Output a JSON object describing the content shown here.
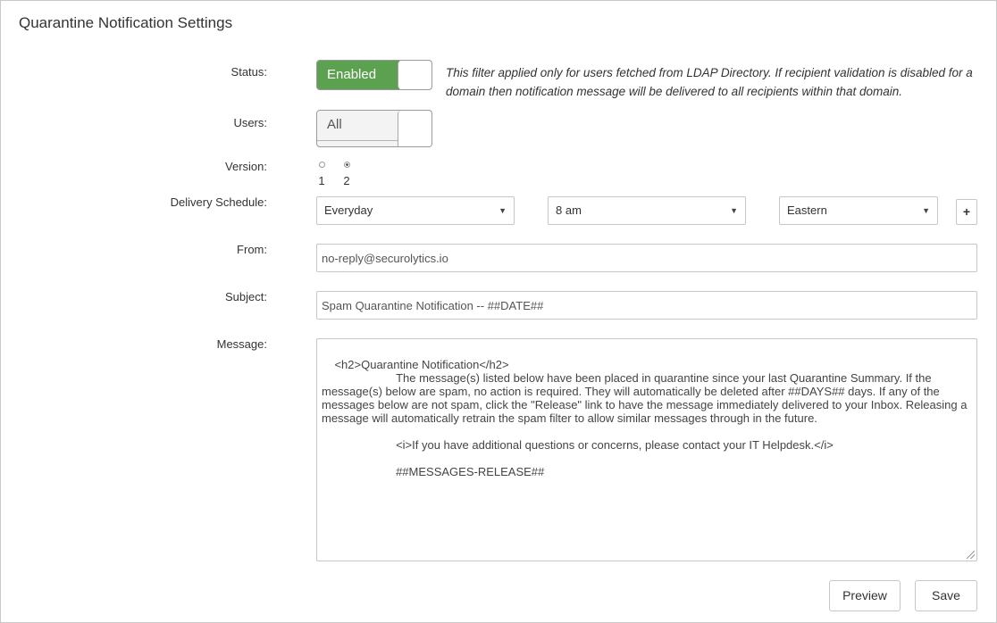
{
  "panel": {
    "title": "Quarantine Notification Settings"
  },
  "status": {
    "label": "Status:",
    "toggle_text": "Enabled",
    "state": "on",
    "hint": "This filter applied only for users fetched from LDAP Directory. If recipient validation is disabled for a domain then notification message will be delivered to all recipients within that domain."
  },
  "users": {
    "label": "Users:",
    "toggle_text": "All",
    "state": "off"
  },
  "version": {
    "label": "Version:",
    "options": [
      "1",
      "2"
    ],
    "selected": "2"
  },
  "delivery": {
    "label": "Delivery Schedule:",
    "frequency": "Everyday",
    "time": "8 am",
    "timezone": "Eastern",
    "add_label": "+"
  },
  "from": {
    "label": "From:",
    "value": "no-reply@securolytics.io"
  },
  "subject": {
    "label": "Subject:",
    "value": "Spam Quarantine Notification -- ##DATE##"
  },
  "message": {
    "label": "Message:",
    "value": "<h2>Quarantine Notification</h2>\n                       The message(s) listed below have been placed in quarantine since your last Quarantine Summary. If the message(s) below are spam, no action is required. They will automatically be deleted after ##DAYS## days. If any of the messages below are not spam, click the \"Release\" link to have the message immediately delivered to your Inbox. Releasing a message will automatically retrain the spam filter to allow similar messages through in the future.\n\n                       <i>If you have additional questions or concerns, please contact your IT Helpdesk.</i>\n\n                       ##MESSAGES-RELEASE##"
  },
  "actions": {
    "preview_label": "Preview",
    "save_label": "Save"
  }
}
